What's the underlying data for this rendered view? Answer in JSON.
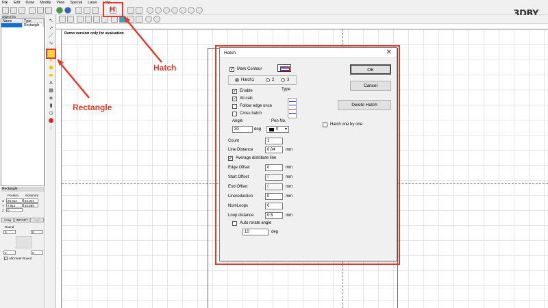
{
  "menu": [
    "File",
    "Edit",
    "Draw",
    "Modify",
    "View",
    "Special",
    "Laser",
    "Help"
  ],
  "brand": {
    "logo_text": "3DBY"
  },
  "object_list": {
    "title": "Object list",
    "columns": [
      "Name",
      "Type"
    ],
    "rows": [
      {
        "name": "",
        "type": "Rectangle"
      }
    ]
  },
  "canvas": {
    "demo_text": "Demo version only for evaluation"
  },
  "rect_panel": {
    "title": "Rectangle",
    "position_label": "Position",
    "size_label": "Size(mm)",
    "x_label": "X",
    "y_label": "Y",
    "z_label": "Z",
    "x_pos": "25.912",
    "y_pos": "7.912",
    "z_pos": "0",
    "x_size": "62.344",
    "y_size": "52.859",
    "tabs": [
      "Array",
      "IMPORT",
      "Apply"
    ],
    "round_label": "Round",
    "round_values": [
      "0",
      "0",
      "0",
      "0"
    ],
    "all_corner_label": "AllCorner Round"
  },
  "callouts": {
    "hatch": "Hatch",
    "rectangle": "Rectangle"
  },
  "dialog": {
    "title": "Hatch",
    "close_glyph": "✕",
    "mark_contour": "Mark Contour",
    "hatch_tabs": [
      "Hatch1",
      "2",
      "3"
    ],
    "enable": "Enable",
    "type_label": "Type",
    "all_calc": "All calc",
    "follow_edge_once": "Follow edge once",
    "cross_hatch": "Cross hatch",
    "angle_label": "Angle",
    "angle_value": "30",
    "angle_unit": "deg",
    "pen_label": "Pen No.",
    "pen_value": "0",
    "count_label": "Count",
    "count_value": "1",
    "line_distance_label": "Line Distance",
    "line_distance_value": "0.04",
    "avg_line": "Average distribute line",
    "edge_offset_label": "Edge Offset",
    "edge_offset_value": "0",
    "start_offset_label": "Start Offset",
    "start_offset_value": "0",
    "end_offset_label": "End Offset",
    "end_offset_value": "0",
    "linereduction_label": "Linereduction",
    "linereduction_value": "0",
    "numloops_label": "NumLoops",
    "numloops_value": "0",
    "loop_distance_label": "Loop distance",
    "loop_distance_value": "0.5",
    "auto_rotate": "Auto rorate angle",
    "auto_rotate_value": "10",
    "auto_rotate_unit": "deg",
    "mm": "mm",
    "ok": "OK",
    "cancel": "Cancel",
    "delete_hatch": "Delete Hatch",
    "hatch_one_by_one": "Hatch one by one"
  }
}
